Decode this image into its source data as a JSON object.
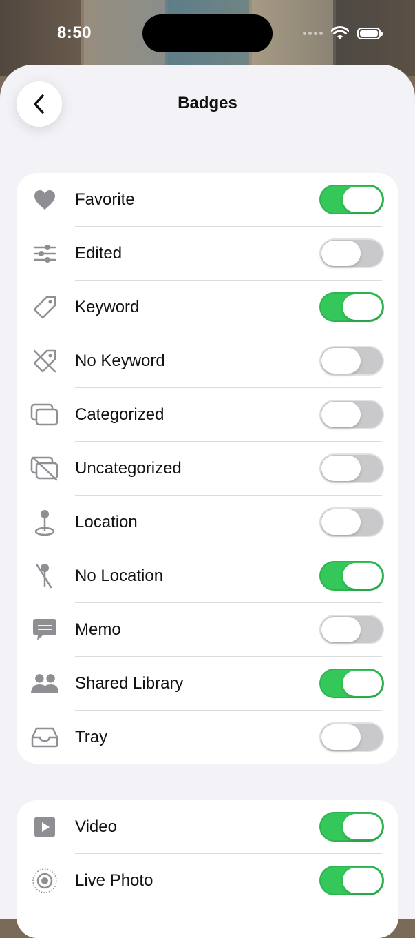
{
  "status": {
    "time": "8:50"
  },
  "header": {
    "title": "Badges",
    "back_icon": "chevron-left-icon"
  },
  "colors": {
    "toggle_on": "#34c759",
    "toggle_off": "#c9c9cc",
    "icon": "#8e8e93"
  },
  "badges": [
    {
      "label": "Favorite",
      "icon": "heart-icon",
      "on": true
    },
    {
      "label": "Edited",
      "icon": "sliders-icon",
      "on": false
    },
    {
      "label": "Keyword",
      "icon": "tag-icon",
      "on": true
    },
    {
      "label": "No Keyword",
      "icon": "tag-slash-icon",
      "on": false
    },
    {
      "label": "Categorized",
      "icon": "rectangles-icon",
      "on": false
    },
    {
      "label": "Uncategorized",
      "icon": "rectangles-slash-icon",
      "on": false
    },
    {
      "label": "Location",
      "icon": "pin-icon",
      "on": false
    },
    {
      "label": "No Location",
      "icon": "pin-slash-icon",
      "on": true
    },
    {
      "label": "Memo",
      "icon": "memo-bubble-icon",
      "on": false
    },
    {
      "label": "Shared Library",
      "icon": "people-icon",
      "on": true
    },
    {
      "label": "Tray",
      "icon": "tray-icon",
      "on": false
    }
  ],
  "media": [
    {
      "label": "Video",
      "icon": "play-icon",
      "on": true
    },
    {
      "label": "Live Photo",
      "icon": "live-photo-icon",
      "on": true
    }
  ]
}
